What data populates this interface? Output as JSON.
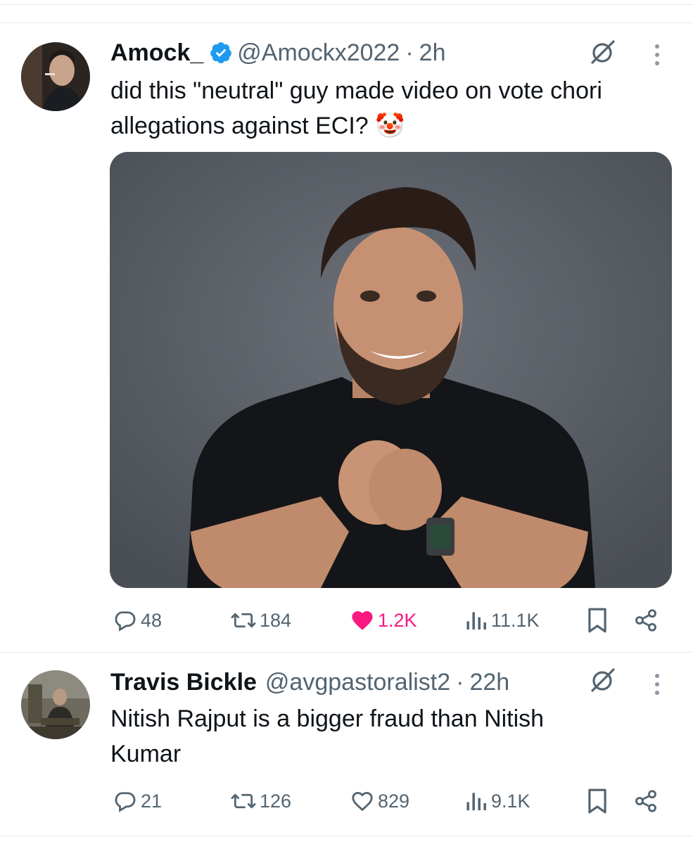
{
  "tweets": [
    {
      "author_name": "Amock_",
      "verified": true,
      "handle": "@Amockx2022",
      "separator": "·",
      "time": "2h",
      "text": "did this \"neutral\" guy made video on vote chori allegations against ECI? 🤡",
      "has_media": true,
      "media_alt": "photo",
      "stats": {
        "replies": "48",
        "reposts": "184",
        "likes": "1.2K",
        "liked": true,
        "views": "11.1K"
      }
    },
    {
      "author_name": "Travis Bickle",
      "verified": false,
      "handle": "@avgpastoralist2",
      "separator": "·",
      "time": "22h",
      "text": "Nitish Rajput is a bigger fraud than Nitish Kumar",
      "has_media": false,
      "stats": {
        "replies": "21",
        "reposts": "126",
        "likes": "829",
        "liked": false,
        "views": "9.1K"
      }
    }
  ],
  "icons": {
    "verified": "verified-badge-icon",
    "grok": "grok-icon",
    "more": "more-options-icon",
    "reply": "reply-icon",
    "repost": "repost-icon",
    "like": "heart-icon",
    "views": "views-chart-icon",
    "bookmark": "bookmark-icon",
    "share": "share-icon"
  },
  "colors": {
    "accent_blue": "#1d9bf0",
    "like_pink": "#f91880",
    "muted_text": "#536471",
    "text": "#0f1419",
    "divider": "#e6ecf0"
  }
}
